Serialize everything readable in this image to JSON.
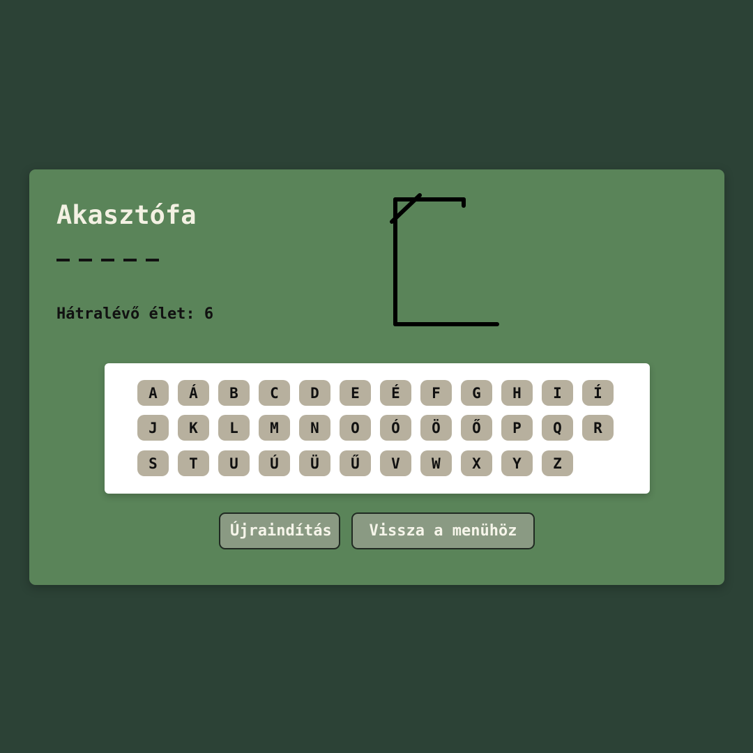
{
  "game": {
    "title": "Akasztófa",
    "word_slots": [
      "_",
      "_",
      "_",
      "_",
      "_"
    ],
    "lives_text": "Hátralévő élet: 6",
    "lives_remaining": 6
  },
  "keyboard": {
    "rows": [
      [
        "A",
        "Á",
        "B",
        "C",
        "D",
        "E",
        "É",
        "F",
        "G",
        "H",
        "I",
        "Í"
      ],
      [
        "J",
        "K",
        "L",
        "M",
        "N",
        "O",
        "Ó",
        "Ö",
        "Ő",
        "P",
        "Q",
        "R"
      ],
      [
        "S",
        "T",
        "U",
        "Ú",
        "Ü",
        "Ű",
        "V",
        "W",
        "X",
        "Y",
        "Z"
      ]
    ]
  },
  "buttons": {
    "restart_label": "Újraindítás",
    "menu_label": "Vissza a menühöz"
  },
  "colors": {
    "background": "#2c4236",
    "card": "#5a8459",
    "key": "#b7b09e",
    "title": "#f3f1e3"
  }
}
